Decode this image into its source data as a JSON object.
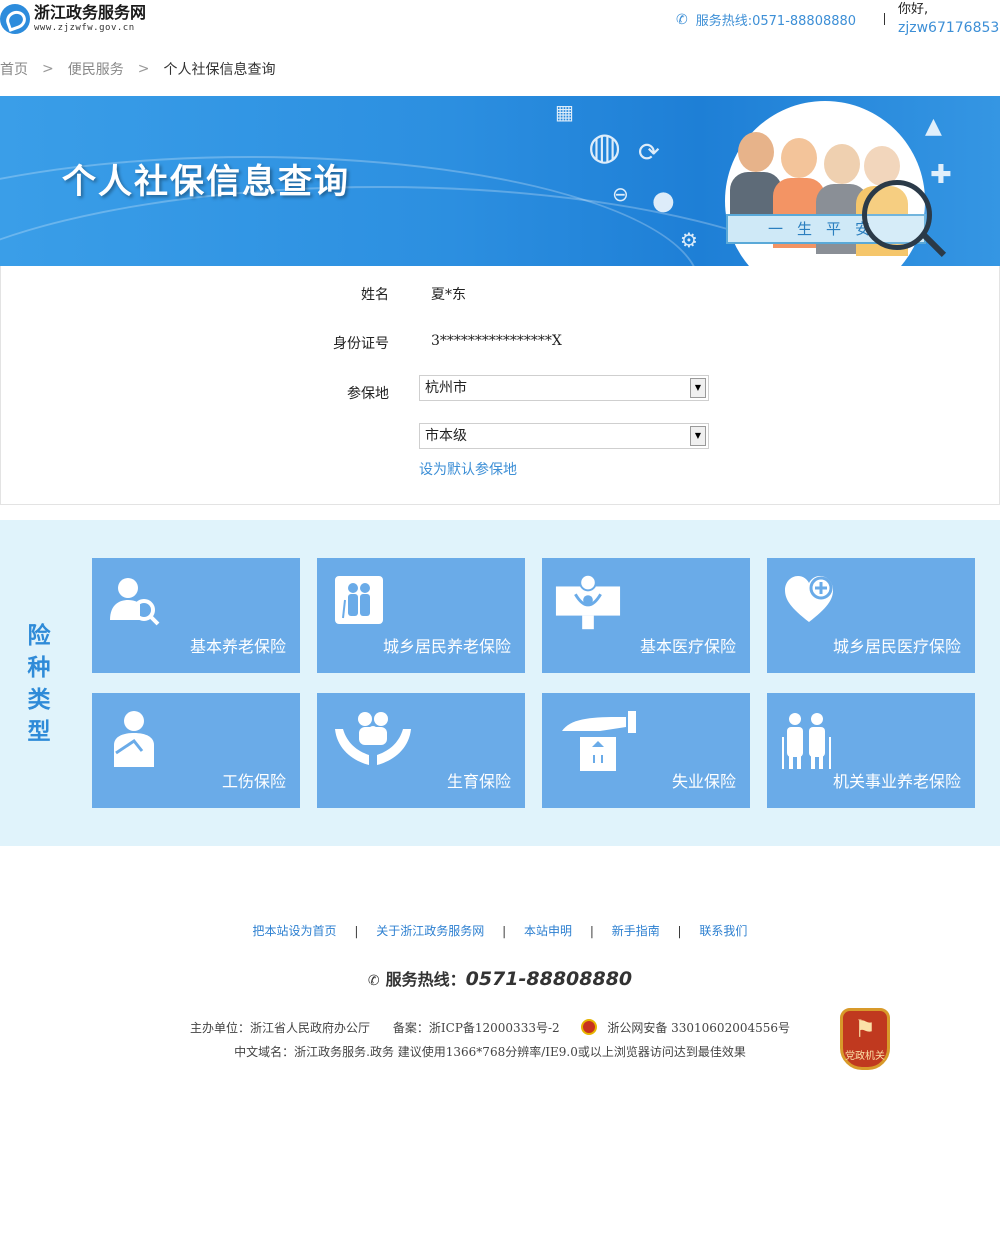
{
  "header": {
    "site_name": "浙江政务服务网",
    "site_domain": "www.zjzwfw.gov.cn",
    "hotline": "服务热线:0571-88808880",
    "greeting": "你好,",
    "username": "zjzw67176853"
  },
  "breadcrumb": {
    "items": [
      "首页",
      "便民服务",
      "个人社保信息查询"
    ],
    "separator": ">"
  },
  "banner": {
    "title": "个人社保信息查询",
    "ribbon_text": "一生平安"
  },
  "form": {
    "name_label": "姓名",
    "name_value": "夏*东",
    "id_label": "身份证号",
    "id_value": "3****************X",
    "region_label": "参保地",
    "city_value": "杭州市",
    "district_value": "市本级",
    "set_default_link": "设为默认参保地"
  },
  "types": {
    "section_label": "险种类型",
    "tiles": [
      {
        "label": "基本养老保险",
        "icon": "user-search-icon"
      },
      {
        "label": "城乡居民养老保险",
        "icon": "elderly-couple-icon"
      },
      {
        "label": "基本医疗保险",
        "icon": "family-care-icon"
      },
      {
        "label": "城乡居民医疗保险",
        "icon": "heart-plus-icon"
      },
      {
        "label": "工伤保险",
        "icon": "injured-person-icon"
      },
      {
        "label": "生育保险",
        "icon": "hands-family-icon"
      },
      {
        "label": "失业保险",
        "icon": "hand-box-icon"
      },
      {
        "label": "机关事业养老保险",
        "icon": "elderly-cane-icon"
      }
    ]
  },
  "footer": {
    "links": [
      "把本站设为首页",
      "关于浙江政务服务网",
      "本站申明",
      "新手指南",
      "联系我们"
    ],
    "hotline_label": "服务热线：",
    "hotline_number": "0571-88808880",
    "sponsor": "主办单位：浙江省人民政府办公厅",
    "icp": "备案：浙ICP备12000333号-2",
    "police": "浙公网安备 33010602004556号",
    "domain_info": "中文域名：浙江政务服务.政务 建议使用1366*768分辨率/IE9.0或以上浏览器访问达到最佳效果",
    "badge_text": "党政机关"
  },
  "colors": {
    "accent": "#3d8fd6",
    "tile": "#6aabe8",
    "types_bg": "#e0f3fb",
    "banner": "#2c8fe0"
  }
}
